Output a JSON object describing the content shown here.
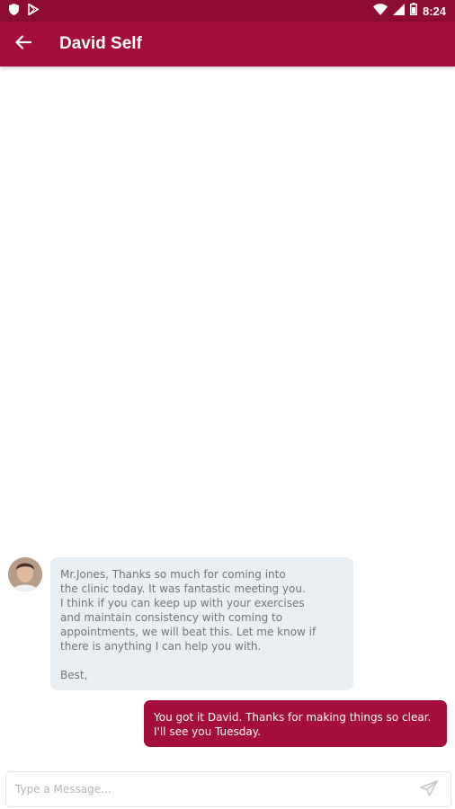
{
  "status_bar": {
    "time": "8:24",
    "left_icons": [
      "shield-icon",
      "play-store-icon"
    ],
    "right_icons": [
      "wifi-icon",
      "signal-icon",
      "battery-icon"
    ],
    "color": "#8e0b33"
  },
  "app_bar": {
    "title": "David Self",
    "back_icon": "arrow-left-icon",
    "color": "#a50d3c"
  },
  "messages": [
    {
      "direction": "incoming",
      "avatar": "contact-avatar",
      "text": "Mr.Jones, Thanks so much for coming into\nthe clinic today. It was fantastic meeting you.\nI think if you can keep up with your exercises\nand maintain consistency with coming to\nappointments, we will beat this. Let me know if\nthere is anything I can help you with.\n\nBest,",
      "bubble_color": "#e9eef3"
    },
    {
      "direction": "outgoing",
      "text": "You got it David. Thanks for making things so clear. I'll see you Tuesday.",
      "bubble_color": "#a50d3c"
    }
  ],
  "composer": {
    "placeholder": "Type a Message...",
    "value": "",
    "send_icon": "send-icon"
  }
}
